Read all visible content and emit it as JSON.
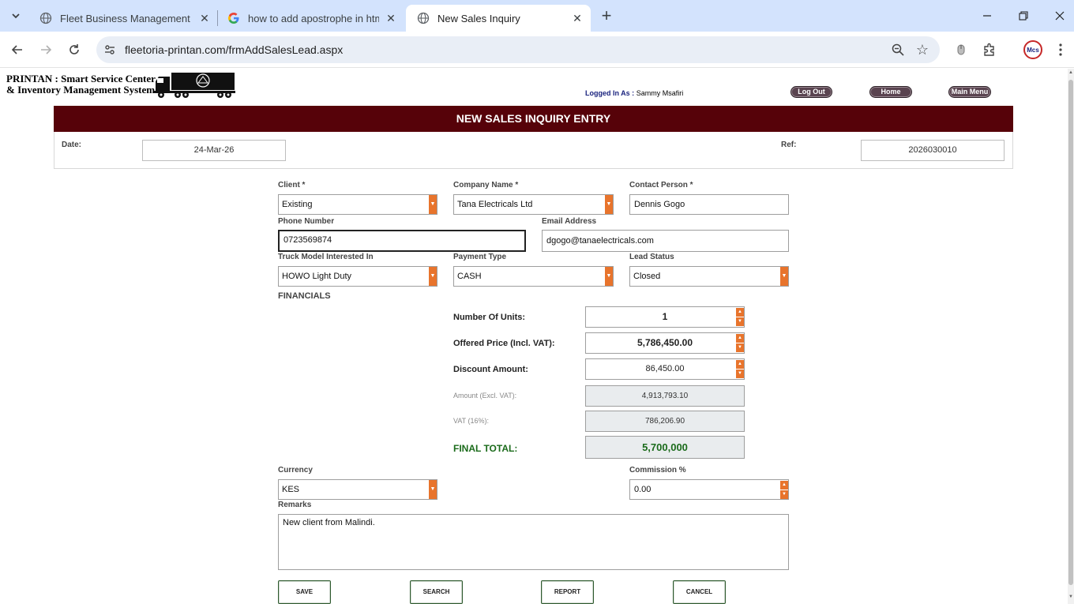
{
  "browser": {
    "tabs": [
      {
        "title": "Fleet Business Management Sol"
      },
      {
        "title": "how to add apostrophe in html"
      },
      {
        "title": "New Sales Inquiry"
      }
    ],
    "url": "fleetoria-printan.com/frmAddSalesLead.aspx",
    "profile_initials": "Mcs"
  },
  "header": {
    "brand_line1": "PRINTAN : Smart Service Center",
    "brand_line2": "& Inventory Management System",
    "logged_in_label": "Logged In As :",
    "logged_in_user": "Sammy Msafiri",
    "logout": "Log Out",
    "home": "Home",
    "main_menu": "Main Menu"
  },
  "form": {
    "title": "NEW SALES INQUIRY ENTRY",
    "date_label": "Date:",
    "date_value": "24-Mar-26",
    "ref_label": "Ref:",
    "ref_value": "2026030010",
    "client_label": "Client *",
    "client_value": "Existing",
    "company_label": "Company Name *",
    "company_value": "Tana Electricals Ltd",
    "contact_label": "Contact Person *",
    "contact_value": "Dennis Gogo",
    "phone_label": "Phone Number",
    "phone_value": "0723569874",
    "email_label": "Email Address",
    "email_value": "dgogo@tanaelectricals.com",
    "truck_label": "Truck Model Interested In",
    "truck_value": "HOWO Light Duty",
    "payment_label": "Payment Type",
    "payment_value": "CASH",
    "status_label": "Lead Status",
    "status_value": "Closed",
    "financials_heading": "FINANCIALS",
    "financials": {
      "units_label": "Number Of Units:",
      "units_value": "1",
      "price_label": "Offered Price (Incl. VAT):",
      "price_value": "5,786,450.00",
      "discount_label": "Discount Amount:",
      "discount_value": "86,450.00",
      "excl_label": "Amount (Excl. VAT):",
      "excl_value": "4,913,793.10",
      "vat_label": "VAT (16%):",
      "vat_value": "786,206.90",
      "total_label": "FINAL TOTAL:",
      "total_value": "5,700,000"
    },
    "currency_label": "Currency",
    "currency_value": "KES",
    "commission_label": "Commission %",
    "commission_value": "0.00",
    "remarks_label": "Remarks",
    "remarks_value": "New client from Malindi."
  },
  "actions": {
    "save": "SAVE",
    "search": "SEARCH",
    "report": "REPORT",
    "cancel": "CANCEL"
  },
  "colors": {
    "title_bar": "#560209",
    "accent_orange": "#e8742c",
    "total_green": "#1b6b1b",
    "tabstrip": "#d3e3fd"
  }
}
